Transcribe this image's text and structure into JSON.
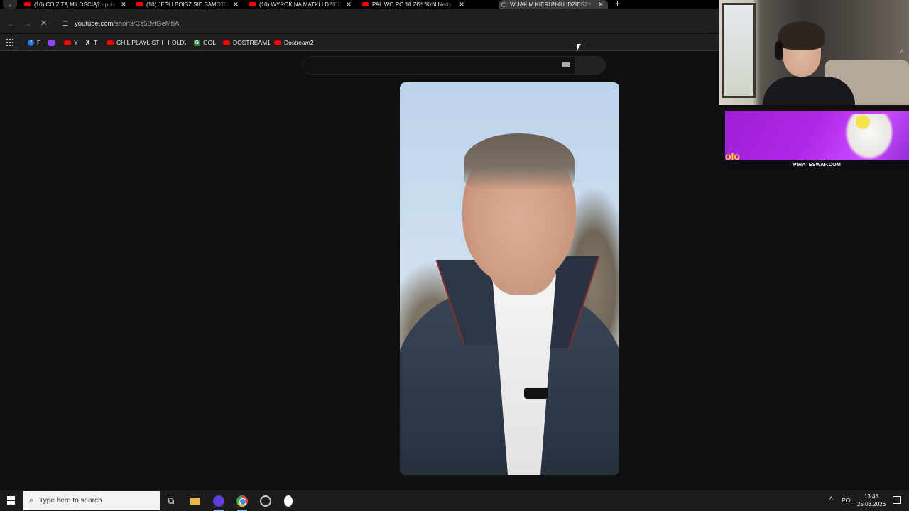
{
  "tabs": [
    {
      "title": "(10) CO Z TĄ MIŁOŚCIĄ? - pole",
      "active": false
    },
    {
      "title": "(10) JEŚLI BOISZ SIE SAMOTNO",
      "active": false
    },
    {
      "title": "(10) WYROK NA MATKI I DZIEC",
      "active": false
    },
    {
      "title": "PALIWO PO 10 Zł?! \"Król biedy",
      "active": false
    },
    {
      "title": "W JAKIM KIERUNKU IDZIESZ? -",
      "active": true
    }
  ],
  "tab_controls": {
    "close_glyph": "✕",
    "new_tab_glyph": "+",
    "menu_glyph": "⌄"
  },
  "toolbar": {
    "url_host": "youtube.com",
    "url_path": "/shorts/Cs58vtGeMbA"
  },
  "bookmarks": [
    {
      "label": "F",
      "icon": "facebook-icon"
    },
    {
      "label": "",
      "icon": "twitch-icon"
    },
    {
      "label": "Y",
      "icon": "youtube-icon"
    },
    {
      "label": "T",
      "icon": "x-icon"
    },
    {
      "label": "CHIL PLAYLIST",
      "icon": "youtube-icon"
    },
    {
      "label": "OLD\\",
      "icon": "folder-icon"
    },
    {
      "label": "GOL",
      "icon": "gol-icon"
    },
    {
      "label": "DOSTREAM1",
      "icon": "youtube-icon"
    },
    {
      "label": "Dostream2",
      "icon": "youtube-icon"
    }
  ],
  "overlay": {
    "banner_site": "PIRATESWAP.COM",
    "banner_logo": "olo"
  },
  "taskbar": {
    "search_placeholder": "Type here to search",
    "language": "POL",
    "time": "13:45",
    "date": "25.03.2026"
  },
  "colors": {
    "page_bg": "#0f0f0f",
    "chrome_bar": "#1f1f1f",
    "youtube_red": "#ff0000",
    "banner_purple": "#b026e6"
  }
}
